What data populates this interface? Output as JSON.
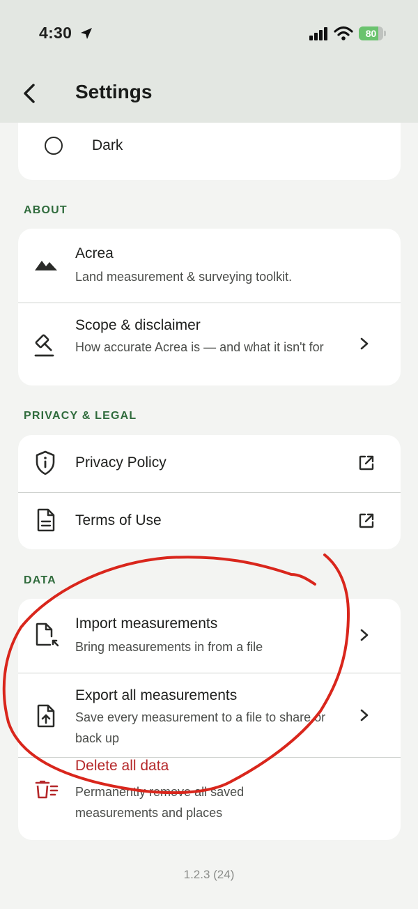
{
  "status_bar": {
    "time": "4:30",
    "battery_level": 80,
    "battery_label": "80",
    "icons": [
      "location-arrow-icon",
      "cellular-signal-icon",
      "wifi-icon",
      "battery-icon"
    ]
  },
  "header": {
    "title": "Settings",
    "back_icon": "chevron-left-icon"
  },
  "appearance": {
    "options": [
      {
        "label": "Dark",
        "selected": false,
        "icon": "radio-unselected-icon"
      }
    ]
  },
  "about": {
    "label": "ABOUT",
    "items": [
      {
        "title": "Acrea",
        "subtitle": "Land measurement & surveying toolkit.",
        "icon": "mountains-icon"
      },
      {
        "title": "Scope & disclaimer",
        "subtitle": "How accurate Acrea is — and what it isn't for",
        "icon": "gavel-icon",
        "trailing": "chevron-right-icon"
      }
    ]
  },
  "privacy_legal": {
    "label": "PRIVACY & LEGAL",
    "items": [
      {
        "title": "Privacy Policy",
        "icon": "shield-info-icon",
        "trailing": "external-link-icon"
      },
      {
        "title": "Terms of Use",
        "icon": "document-icon",
        "trailing": "external-link-icon"
      }
    ]
  },
  "data_section": {
    "label": "DATA",
    "items": [
      {
        "title": "Import measurements",
        "subtitle": "Bring measurements in from a file",
        "icon": "file-import-icon",
        "trailing": "chevron-right-icon"
      },
      {
        "title": "Export all measurements",
        "subtitle": "Save every measurement to a file to share or back up",
        "icon": "file-export-icon",
        "trailing": "chevron-right-icon"
      },
      {
        "title": "Delete all data",
        "subtitle": "Permanently remove all saved measurements and places",
        "icon": "trash-list-icon",
        "danger": true
      }
    ]
  },
  "footer": {
    "version": "1.2.3 (24)"
  },
  "colors": {
    "header_bg": "#e3e7e2",
    "page_bg": "#f3f4f2",
    "section_label": "#2f6b3c",
    "danger": "#b5282a",
    "annotation": "#d9261c",
    "battery": "#6ac36e"
  }
}
